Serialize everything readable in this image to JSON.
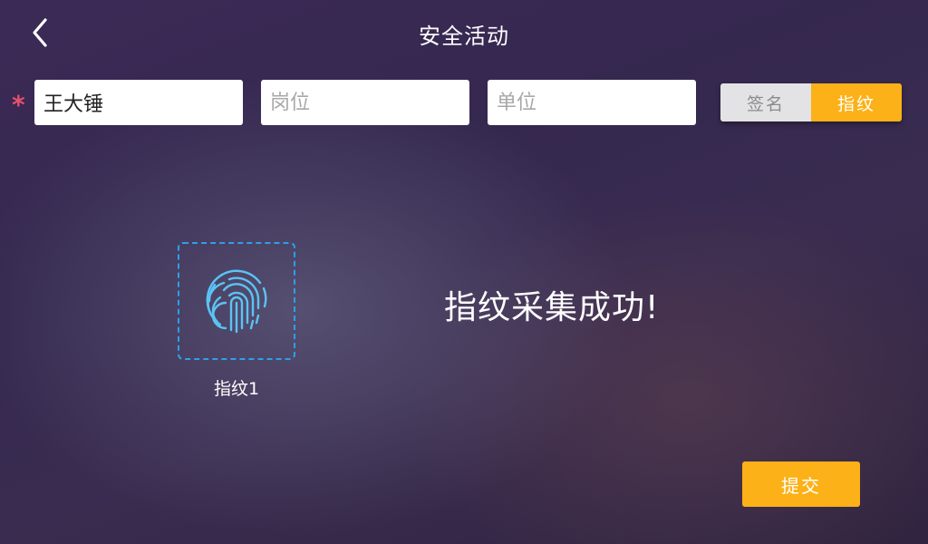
{
  "header": {
    "title": "安全活动",
    "back_icon": "chevron-left-icon"
  },
  "form": {
    "required_mark": "*",
    "name_value": "王大锤",
    "position_placeholder": "岗位",
    "unit_placeholder": "单位"
  },
  "mode_toggle": {
    "options": [
      "签名",
      "指纹"
    ],
    "selected": "指纹"
  },
  "fingerprint": {
    "icon": "fingerprint-icon",
    "label": "指纹1"
  },
  "status_message": "指纹采集成功!",
  "submit_label": "提交",
  "colors": {
    "accent": "#fbb117",
    "fingerprint_blue": "#2e9fe8",
    "required_red": "#e8506e",
    "toggle_inactive_bg": "#e3e3e5",
    "toggle_inactive_text": "#8a8a8a"
  }
}
